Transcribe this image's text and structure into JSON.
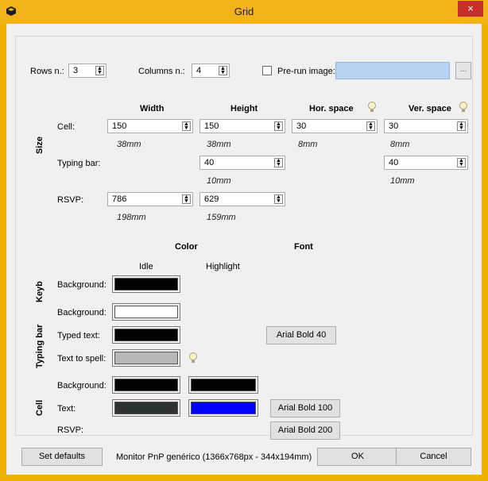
{
  "window": {
    "title": "Grid",
    "close_glyph": "×"
  },
  "top_row": {
    "rows_label": "Rows n.:",
    "rows_value": "3",
    "columns_label": "Columns n.:",
    "columns_value": "4",
    "prerun_label": "Pre-run image:",
    "browse_label": "..."
  },
  "size": {
    "section_label": "Size",
    "headers": {
      "width": "Width",
      "height": "Height",
      "hspace": "Hor. space",
      "vspace": "Ver. space"
    },
    "cell": {
      "label": "Cell:",
      "width": "150",
      "height": "150",
      "hspace": "30",
      "vspace": "30",
      "width_mm": "38mm",
      "height_mm": "38mm",
      "hspace_mm": "8mm",
      "vspace_mm": "8mm"
    },
    "typing_bar": {
      "label": "Typing bar:",
      "height": "40",
      "vspace": "40",
      "height_mm": "10mm",
      "vspace_mm": "10mm"
    },
    "rsvp": {
      "label": "RSVP:",
      "width": "786",
      "height": "629",
      "width_mm": "198mm",
      "height_mm": "159mm"
    }
  },
  "colors": {
    "header_color": "Color",
    "header_font": "Font",
    "idle": "Idle",
    "highlight": "Highlight",
    "keyb": {
      "section_label": "Keyb",
      "background_label": "Background:",
      "background_idle": "#000000"
    },
    "typing_bar": {
      "section_label": "Typing bar",
      "background_label": "Background:",
      "background_idle": "#ffffff",
      "typed_label": "Typed text:",
      "typed_idle": "#000000",
      "typed_font": "Arial Bold   40",
      "spell_label": "Text to spell:",
      "spell_idle": "#b7b9b4"
    },
    "cell": {
      "section_label": "Cell",
      "background_label": "Background:",
      "background_idle": "#000000",
      "background_highlight": "#000000",
      "text_label": "Text:",
      "text_idle": "#2c3230",
      "text_highlight": "#0000ff",
      "text_font": "Arial Bold   100",
      "rsvp_label": "RSVP:",
      "rsvp_font": "Arial Bold   200"
    }
  },
  "footer": {
    "set_defaults": "Set defaults",
    "monitor": "Monitor PnP genérico (1366x768px - 344x194mm)",
    "ok": "OK",
    "cancel": "Cancel"
  }
}
